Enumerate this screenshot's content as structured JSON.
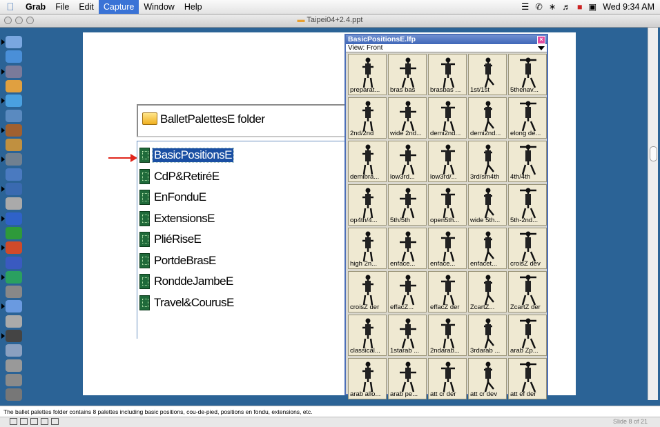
{
  "menubar": {
    "app": "Grab",
    "items": [
      "File",
      "Edit",
      "Capture",
      "Window",
      "Help"
    ],
    "active": "Capture",
    "clock": "Wed 9:34 AM"
  },
  "window": {
    "title": "Taipei04+2.4.ppt"
  },
  "slide": {
    "folder_label": "BalletPalettesE folder",
    "files": [
      {
        "label": "BasicPositionsE",
        "selected": true
      },
      {
        "label": "CdP&RetiréE"
      },
      {
        "label": "EnFonduE"
      },
      {
        "label": "ExtensionsE"
      },
      {
        "label": "PliéRiseE"
      },
      {
        "label": "PortdeBrasE"
      },
      {
        "label": "RonddeJambeE"
      },
      {
        "label": "Travel&CourusE"
      }
    ],
    "arrow_color": "#e0251b"
  },
  "palette": {
    "title": "BasicPositionsE.lfp",
    "view": "View: Front",
    "cells": [
      "preparat...",
      "bras bas",
      "brasbas ...",
      "1st/1st",
      "5thenav...",
      "2nd/2nd",
      "wide 2nd...",
      "demi2nd...",
      "demi2nd...",
      "elong de...",
      "demibra...",
      "low3rd...",
      "low3rd/...",
      "3rd/sm4th",
      "4th/4th",
      "op4th/4...",
      "5th/5th",
      "open5th...",
      "wide 5th...",
      "5th-2nd...",
      "high 2n...",
      "enface...",
      "enface...",
      "enfacet...",
      "croisZ dev",
      "croisZ der",
      "effacZ...",
      "effacZ der",
      "ZcartZ...",
      "ZcartZ der",
      "classical...",
      "1starab ...",
      "2ndarab...",
      "3rdarab ...",
      "arab Zp...",
      "arab allo...",
      "arab pe...",
      "att cr der",
      "att cr dev",
      "att ef der"
    ]
  },
  "notes": "The ballet palettes folder contains 8 palettes including basic positions, cou-de-pied, positions en fondu, extensions, etc.",
  "status": {
    "slide": "Slide 8 of 21"
  },
  "dock_icons": [
    "finder-icon",
    "safari-icon",
    "mail-icon",
    "ical-icon",
    "itunes-icon",
    "iphoto-icon",
    "imovie-icon",
    "garageband-icon",
    "preferences-icon",
    "calendar-icon",
    "search-icon",
    "disk-icon",
    "word-icon",
    "excel-icon",
    "powerpoint-icon",
    "entourage-icon",
    "messenger-icon",
    "textedit-icon",
    "preview-icon",
    "grab-icon",
    "terminal-icon",
    "image-icon",
    "magnifier-icon",
    "app-icon",
    "trash-icon"
  ]
}
